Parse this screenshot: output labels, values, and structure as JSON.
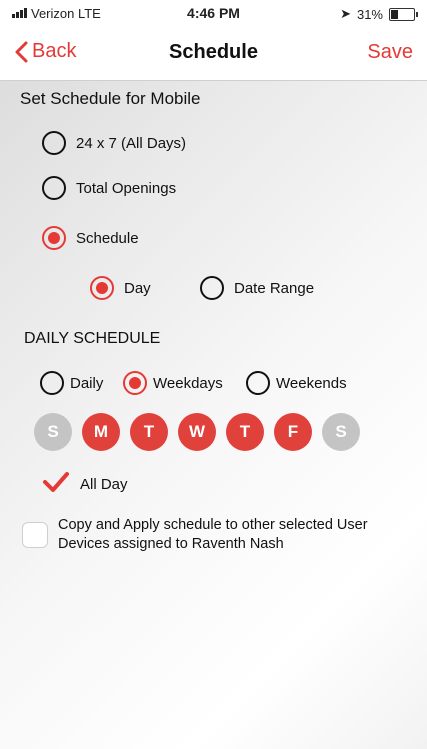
{
  "status_bar": {
    "carrier": "Verizon  LTE",
    "time": "4:46 PM",
    "battery": "31%",
    "battery_level": 0.31
  },
  "nav": {
    "back_label": "Back",
    "title": "Schedule",
    "save_label": "Save",
    "accent_color": "#e53935"
  },
  "schedule_type": {
    "heading": "Set Schedule for Mobile",
    "options": [
      {
        "label": "24 x 7 (All Days)",
        "selected": false
      },
      {
        "label": "Total Openings",
        "selected": false
      },
      {
        "label": "Schedule",
        "selected": true
      }
    ]
  },
  "schedule_mode": {
    "options": [
      {
        "label": "Day",
        "selected": true
      },
      {
        "label": "Date Range",
        "selected": false
      }
    ]
  },
  "daily": {
    "heading": "DAILY SCHEDULE",
    "options": [
      {
        "label": "Daily",
        "selected": false
      },
      {
        "label": "Weekdays",
        "selected": true
      },
      {
        "label": "Weekends",
        "selected": false
      }
    ],
    "days": [
      {
        "letter": "S",
        "selected": false
      },
      {
        "letter": "M",
        "selected": true
      },
      {
        "letter": "T",
        "selected": true
      },
      {
        "letter": "W",
        "selected": true
      },
      {
        "letter": "T",
        "selected": true
      },
      {
        "letter": "F",
        "selected": true
      },
      {
        "letter": "S",
        "selected": false
      }
    ],
    "all_day_label": "All Day",
    "all_day_checked": true
  },
  "copy_apply": {
    "label": "Copy and Apply schedule to other selected User Devices assigned to Raventh  Nash",
    "checked": false
  }
}
